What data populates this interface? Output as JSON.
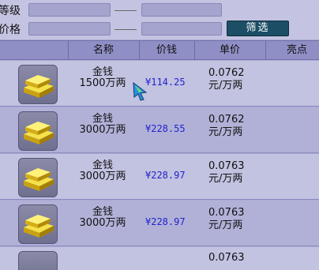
{
  "filter": {
    "level_label": "等级",
    "price_label": "价格",
    "filter_button": "筛选"
  },
  "table": {
    "headers": [
      "名称",
      "价钱",
      "单价",
      "亮点"
    ],
    "rows": [
      {
        "name": "金钱",
        "amount": "1500万两",
        "price": "¥114.25",
        "unit_price": "0.0762",
        "unit_suffix": "元/万两",
        "icon": "gold-bars-icon"
      },
      {
        "name": "金钱",
        "amount": "3000万两",
        "price": "¥228.55",
        "unit_price": "0.0762",
        "unit_suffix": "元/万两",
        "icon": "gold-bars-icon"
      },
      {
        "name": "金钱",
        "amount": "3000万两",
        "price": "¥228.97",
        "unit_price": "0.0763",
        "unit_suffix": "元/万两",
        "icon": "gold-bars-icon"
      },
      {
        "name": "金钱",
        "amount": "3000万两",
        "price": "¥228.97",
        "unit_price": "0.0763",
        "unit_suffix": "元/万两",
        "icon": "gold-bars-icon"
      },
      {
        "name": "",
        "amount": "",
        "price": "",
        "unit_price": "0.0763",
        "unit_suffix": "",
        "icon": "gold-bars-icon"
      }
    ]
  },
  "colors": {
    "accent_button": "#1c4e66",
    "price_text": "#2222cc",
    "header_bg": "#8f8fc6"
  }
}
